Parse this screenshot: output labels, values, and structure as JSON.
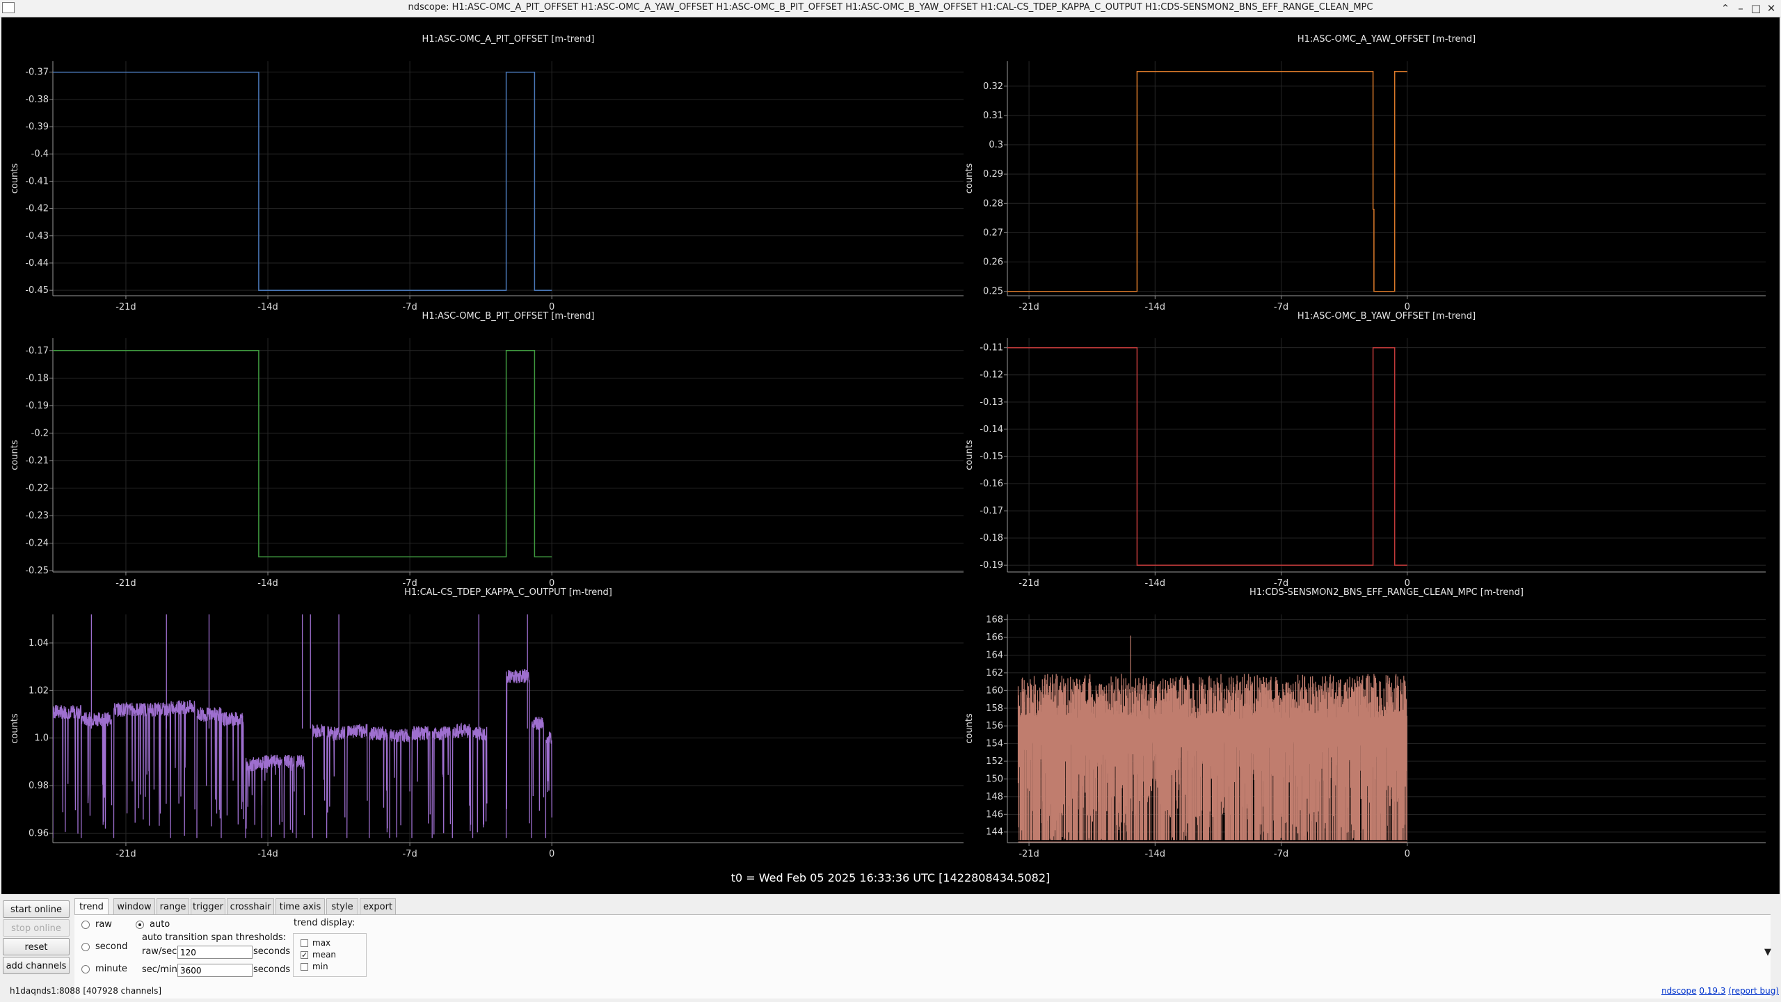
{
  "window": {
    "title": "ndscope: H1:ASC-OMC_A_PIT_OFFSET H1:ASC-OMC_A_YAW_OFFSET H1:ASC-OMC_B_PIT_OFFSET H1:ASC-OMC_B_YAW_OFFSET H1:CAL-CS_TDEP_KAPPA_C_OUTPUT H1:CDS-SENSMON2_BNS_EFF_RANGE_CLEAN_MPC",
    "buttons": {
      "restore": "⌃",
      "minimize": "–",
      "maximize": "□",
      "close": "✕"
    }
  },
  "chart_data": [
    {
      "type": "line",
      "title": "H1:ASC-OMC_A_PIT_OFFSET [m-trend]",
      "ylabel": "counts",
      "color": "#4a78b8",
      "xlim": [
        -24.6,
        20.3
      ],
      "ylim": [
        -0.452,
        -0.366
      ],
      "xticks": [
        -21,
        -14,
        -7,
        0
      ],
      "xtick_labels": [
        "-21d",
        "-14d",
        "-7d",
        "0"
      ],
      "yticks": [
        -0.37,
        -0.38,
        -0.39,
        -0.4,
        -0.41,
        -0.42,
        -0.43,
        -0.44,
        -0.45
      ],
      "ytick_labels": [
        "-0.37",
        "-0.38",
        "-0.39",
        "-0.4",
        "-0.41",
        "-0.42",
        "-0.43",
        "-0.44",
        "-0.45"
      ],
      "x": [
        -24.6,
        -14.5,
        -14.5,
        1.0,
        -1.0,
        -1.0,
        -1.0,
        -1.0,
        -1.0
      ],
      "points": [
        [
          -24.6,
          -0.37
        ],
        [
          -14.45,
          -0.37
        ],
        [
          -14.45,
          -0.45
        ],
        [
          -2.25,
          -0.45
        ],
        [
          -2.25,
          -0.37
        ],
        [
          -0.85,
          -0.37
        ],
        [
          -0.85,
          -0.45
        ],
        [
          0,
          -0.45
        ]
      ]
    },
    {
      "type": "line",
      "title": "H1:ASC-OMC_A_YAW_OFFSET [m-trend]",
      "ylabel": "counts",
      "color": "#d9792a",
      "xlim": [
        -22.2,
        19.9
      ],
      "ylim": [
        0.2485,
        0.3285
      ],
      "xticks": [
        -21,
        -14,
        -7,
        0
      ],
      "xtick_labels": [
        "-21d",
        "-14d",
        "-7d",
        "0"
      ],
      "yticks": [
        0.32,
        0.31,
        0.3,
        0.29,
        0.28,
        0.27,
        0.26,
        0.25
      ],
      "ytick_labels": [
        "0.32",
        "0.31",
        "0.3",
        "0.29",
        "0.28",
        "0.27",
        "0.26",
        "0.25"
      ],
      "points": [
        [
          -22.2,
          0.25
        ],
        [
          -15.0,
          0.25
        ],
        [
          -15.0,
          0.325
        ],
        [
          -1.9,
          0.325
        ],
        [
          -1.9,
          0.278
        ],
        [
          -1.85,
          0.278
        ],
        [
          -1.85,
          0.25
        ],
        [
          -0.7,
          0.25
        ],
        [
          -0.7,
          0.325
        ],
        [
          0,
          0.325
        ]
      ]
    },
    {
      "type": "line",
      "title": "H1:ASC-OMC_B_PIT_OFFSET [m-trend]",
      "ylabel": "counts",
      "color": "#3f9a3f",
      "xlim": [
        -24.6,
        20.3
      ],
      "ylim": [
        -0.2505,
        -0.1655
      ],
      "xticks": [
        -21,
        -14,
        -7,
        0
      ],
      "xtick_labels": [
        "-21d",
        "-14d",
        "-7d",
        "0"
      ],
      "yticks": [
        -0.17,
        -0.18,
        -0.19,
        -0.2,
        -0.21,
        -0.22,
        -0.23,
        -0.24,
        -0.25
      ],
      "ytick_labels": [
        "-0.17",
        "-0.18",
        "-0.19",
        "-0.2",
        "-0.21",
        "-0.22",
        "-0.23",
        "-0.24",
        "-0.25"
      ],
      "points": [
        [
          -24.6,
          -0.17
        ],
        [
          -14.45,
          -0.17
        ],
        [
          -14.45,
          -0.245
        ],
        [
          -2.25,
          -0.245
        ],
        [
          -2.25,
          -0.17
        ],
        [
          -0.85,
          -0.17
        ],
        [
          -0.85,
          -0.245
        ],
        [
          0,
          -0.245
        ]
      ]
    },
    {
      "type": "line",
      "title": "H1:ASC-OMC_B_YAW_OFFSET [m-trend]",
      "ylabel": "counts",
      "color": "#c23b3b",
      "xlim": [
        -22.2,
        19.9
      ],
      "ylim": [
        -0.1925,
        -0.1065
      ],
      "xticks": [
        -21,
        -14,
        -7,
        0
      ],
      "xtick_labels": [
        "-21d",
        "-14d",
        "-7d",
        "0"
      ],
      "yticks": [
        -0.11,
        -0.12,
        -0.13,
        -0.14,
        -0.15,
        -0.16,
        -0.17,
        -0.18,
        -0.19
      ],
      "ytick_labels": [
        "-0.11",
        "-0.12",
        "-0.13",
        "-0.14",
        "-0.15",
        "-0.16",
        "-0.17",
        "-0.18",
        "-0.19"
      ],
      "points": [
        [
          -22.2,
          -0.11
        ],
        [
          -15.0,
          -0.11
        ],
        [
          -15.0,
          -0.19
        ],
        [
          -1.9,
          -0.19
        ],
        [
          -1.9,
          -0.11
        ],
        [
          -0.7,
          -0.11
        ],
        [
          -0.7,
          -0.19
        ],
        [
          0,
          -0.19
        ]
      ]
    },
    {
      "type": "line",
      "title": "H1:CAL-CS_TDEP_KAPPA_C_OUTPUT [m-trend]",
      "ylabel": "counts",
      "color": "#9e6fcf",
      "xlim": [
        -24.6,
        20.3
      ],
      "ylim": [
        0.956,
        1.052
      ],
      "xticks": [
        -21,
        -14,
        -7,
        0
      ],
      "xtick_labels": [
        "-21d",
        "-14d",
        "-7d",
        "0"
      ],
      "yticks": [
        1.04,
        1.02,
        1.0,
        0.98,
        0.96
      ],
      "ytick_labels": [
        "1.04",
        "1.02",
        "1.0",
        "0.98",
        "0.96"
      ],
      "plateaus": [
        [
          -24.6,
          -23.2,
          1.011
        ],
        [
          -23.2,
          -21.7,
          1.008
        ],
        [
          -21.6,
          -18.8,
          1.012
        ],
        [
          -18.8,
          -17.6,
          1.013
        ],
        [
          -17.5,
          -16.3,
          1.01
        ],
        [
          -16.3,
          -15.2,
          1.008
        ],
        [
          -15.1,
          -14.3,
          0.989
        ],
        [
          -14.3,
          -13.3,
          0.99
        ],
        [
          -13.2,
          -12.7,
          0.99
        ],
        [
          -12.6,
          -12.2,
          0.99
        ],
        [
          -11.8,
          -11.2,
          1.003
        ],
        [
          -11.1,
          -10.2,
          1.002
        ],
        [
          -10.1,
          -9.1,
          1.003
        ],
        [
          -9.0,
          -8.1,
          1.002
        ],
        [
          -8.0,
          -7.0,
          1.001
        ],
        [
          -6.9,
          -6.0,
          1.002
        ],
        [
          -5.9,
          -5.0,
          1.002
        ],
        [
          -4.9,
          -4.0,
          1.003
        ],
        [
          -3.9,
          -3.2,
          1.002
        ],
        [
          -2.25,
          -1.1,
          1.026
        ],
        [
          -1.0,
          -0.4,
          1.006
        ],
        [
          -0.3,
          0,
          1.0
        ]
      ],
      "floor": 0.958
    },
    {
      "type": "line",
      "title": "H1:CDS-SENSMON2_BNS_EFF_RANGE_CLEAN_MPC [m-trend]",
      "ylabel": "counts",
      "color": "#c07d6e",
      "xlim": [
        -22.2,
        19.9
      ],
      "ylim": [
        142.8,
        168.6
      ],
      "xticks": [
        -21,
        -14,
        -7,
        0
      ],
      "xtick_labels": [
        "-21d",
        "-14d",
        "-7d",
        "0"
      ],
      "yticks": [
        168,
        166,
        164,
        162,
        160,
        158,
        156,
        154,
        152,
        150,
        148,
        146,
        144
      ],
      "ytick_labels": [
        "168",
        "166",
        "164",
        "162",
        "160",
        "158",
        "156",
        "154",
        "152",
        "150",
        "148",
        "146",
        "144"
      ],
      "range_start": -21.6,
      "range_end": 0,
      "typical": 158.5,
      "peak": 166.2
    }
  ],
  "t0": "t0 = Wed Feb 05 2025 16:33:36 UTC [1422808434.5082]",
  "left_buttons": [
    "start online",
    "stop online",
    "reset",
    "add channels"
  ],
  "tabs": [
    "trend",
    "window",
    "range",
    "trigger",
    "crosshair",
    "time axis",
    "style",
    "export"
  ],
  "trend_panel": {
    "radios_left": [
      "raw",
      "second",
      "minute"
    ],
    "radio_auto": "auto",
    "thresholds_label": "auto transition span thresholds:",
    "raw_sec_label": "raw/sec:",
    "raw_sec_value": "120",
    "sec_min_label": "sec/min:",
    "sec_min_value": "3600",
    "seconds": "seconds",
    "trend_display_label": "trend display:",
    "display_options": [
      "max",
      "mean",
      "min"
    ]
  },
  "status": "h1daqnds1:8088  [407928 channels]",
  "version": {
    "name": "ndscope",
    "number": "0.19.3",
    "bug": "(report bug)"
  },
  "collapse_icon": "▼"
}
